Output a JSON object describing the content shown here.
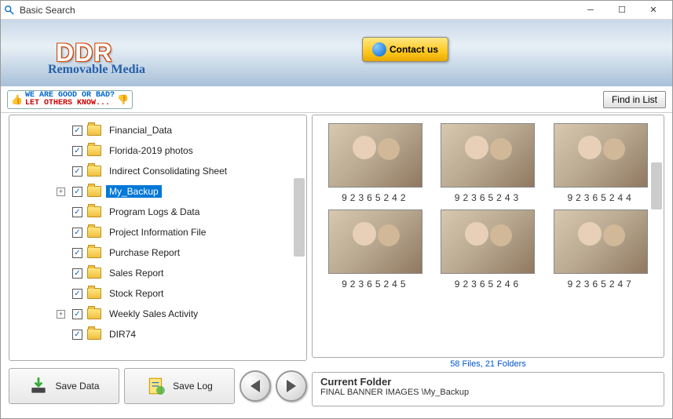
{
  "window": {
    "title": "Basic Search"
  },
  "banner": {
    "brand": "DDR",
    "subtitle": "Removable Media",
    "contact": "Contact us"
  },
  "feedback": {
    "line1": "WE ARE GOOD OR BAD?",
    "line2": "LET OTHERS KNOW..."
  },
  "toolbar": {
    "find_in_list": "Find in List"
  },
  "tree": {
    "items": [
      {
        "label": "Financial_Data",
        "expandable": false
      },
      {
        "label": "Florida-2019 photos",
        "expandable": false
      },
      {
        "label": "Indirect Consolidating Sheet",
        "expandable": false
      },
      {
        "label": "My_Backup",
        "expandable": true,
        "selected": true
      },
      {
        "label": "Program Logs & Data",
        "expandable": false
      },
      {
        "label": "Project Information File",
        "expandable": false
      },
      {
        "label": "Purchase Report",
        "expandable": false
      },
      {
        "label": "Sales Report",
        "expandable": false
      },
      {
        "label": "Stock Report",
        "expandable": false
      },
      {
        "label": "Weekly Sales Activity",
        "expandable": true
      },
      {
        "label": "DIR74",
        "expandable": false
      }
    ]
  },
  "buttons": {
    "save_data": "Save Data",
    "save_log": "Save Log"
  },
  "thumbs": [
    {
      "label": "92365242"
    },
    {
      "label": "92365243"
    },
    {
      "label": "92365244"
    },
    {
      "label": "92365245"
    },
    {
      "label": "92365246"
    },
    {
      "label": "92365247"
    }
  ],
  "status": {
    "summary": "58 Files, 21 Folders"
  },
  "current_folder": {
    "title": "Current Folder",
    "path": "FINAL BANNER IMAGES \\My_Backup"
  }
}
